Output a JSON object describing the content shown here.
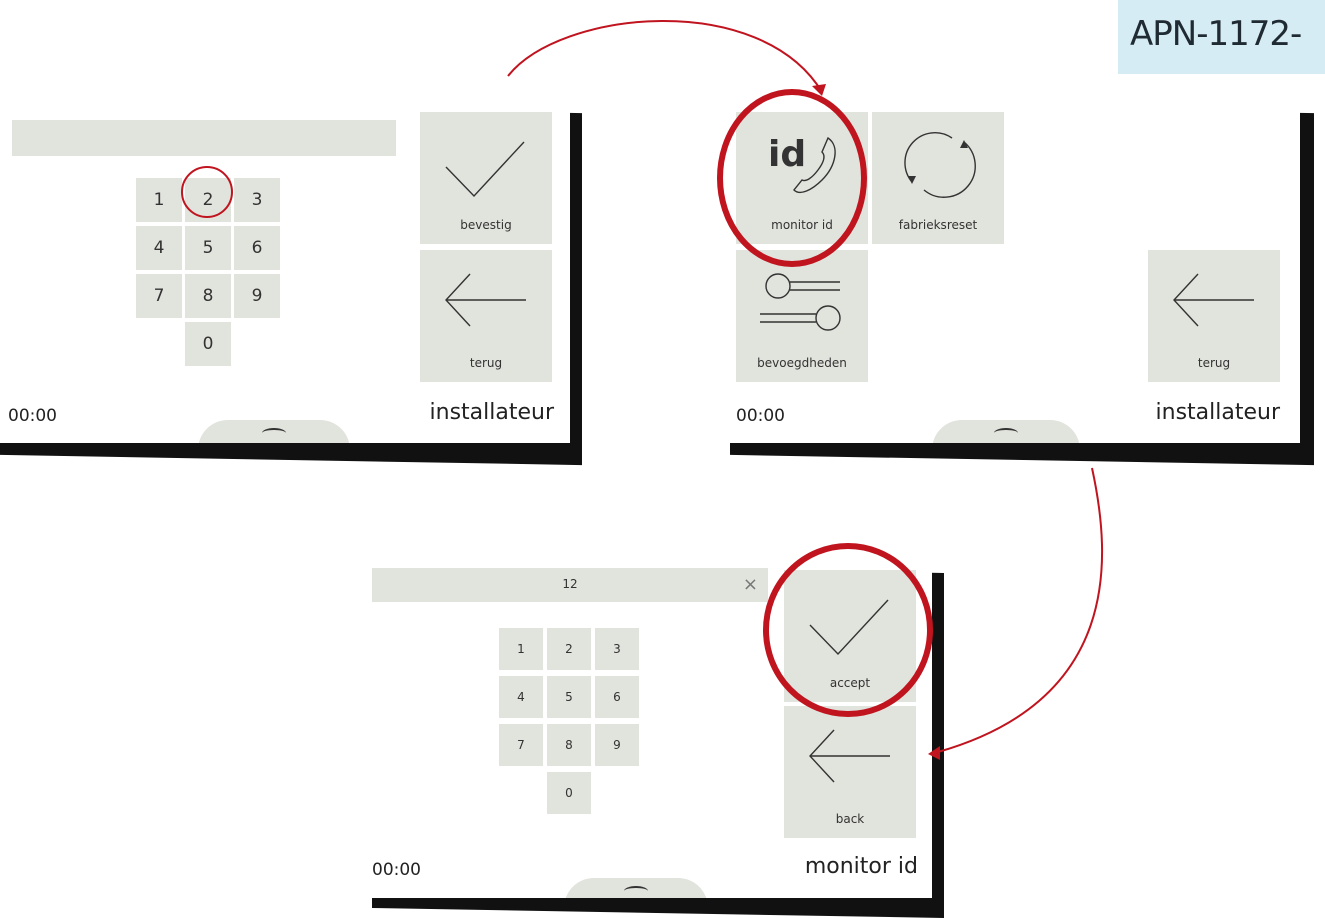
{
  "doc_tag": "APN-1172-",
  "screen_a": {
    "keys": [
      "1",
      "2",
      "3",
      "4",
      "5",
      "6",
      "7",
      "8",
      "9",
      "0"
    ],
    "confirm_label": "bevestig",
    "back_label": "terug",
    "time": "00:00",
    "title": "installateur"
  },
  "screen_b": {
    "tiles": {
      "monitor_id_icon_text": "id",
      "monitor_id_label": "monitor id",
      "factory_reset_label": "fabrieksreset",
      "permissions_label": "bevoegdheden"
    },
    "back_label": "terug",
    "time": "00:00",
    "title": "installateur"
  },
  "screen_c": {
    "entry_value": "12",
    "keys": [
      "1",
      "2",
      "3",
      "4",
      "5",
      "6",
      "7",
      "8",
      "9",
      "0"
    ],
    "accept_label": "accept",
    "back_label": "back",
    "time": "00:00",
    "title": "monitor id"
  },
  "colors": {
    "highlight_red": "#c0141f",
    "button_grey": "#e1e3dd",
    "tag_blue": "#d6ecf5"
  }
}
